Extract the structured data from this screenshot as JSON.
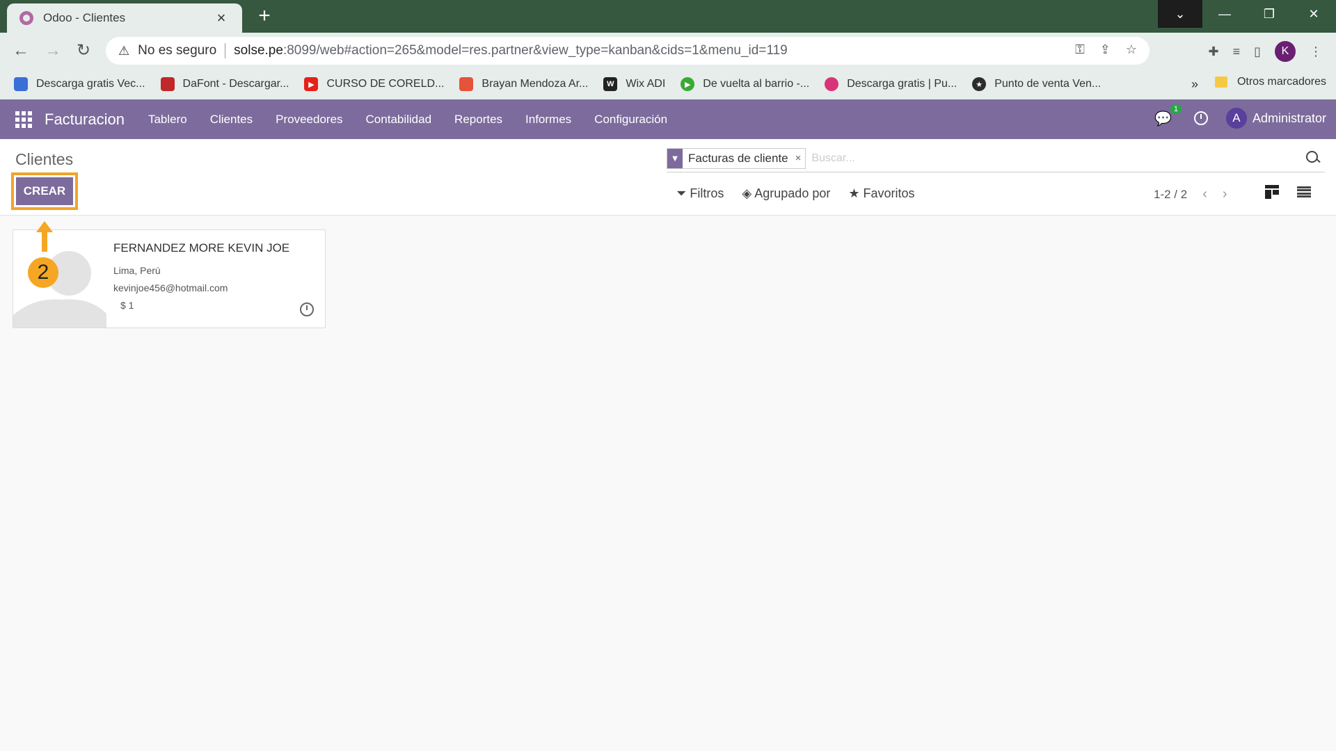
{
  "browser": {
    "tab_title": "Odoo - Clientes",
    "new_tab_symbol": "+",
    "not_secure_label": "No es seguro",
    "url_host": "solse.pe",
    "url_rest": ":8099/web#action=265&model=res.partner&view_type=kanban&cids=1&menu_id=119",
    "profile_initial": "K",
    "bookmarks": [
      {
        "label": "Descarga gratis Vec...",
        "color": "#3a6fd8"
      },
      {
        "label": "DaFont - Descargar...",
        "color": "#c0282a"
      },
      {
        "label": "CURSO DE CORELD...",
        "color": "#e62117"
      },
      {
        "label": "Brayan Mendoza Ar...",
        "color": "#e5533b"
      },
      {
        "label": "Wix ADI",
        "color": "#222222"
      },
      {
        "label": "De vuelta al barrio -...",
        "color": "#3aa935"
      },
      {
        "label": "Descarga gratis | Pu...",
        "color": "#d9337a"
      },
      {
        "label": "Punto de venta Ven...",
        "color": "#2c2c2c"
      }
    ],
    "bookmarks_more": "»",
    "other_bookmarks": "Otros marcadores"
  },
  "odoo_nav": {
    "brand": "Facturacion",
    "menu": [
      "Tablero",
      "Clientes",
      "Proveedores",
      "Contabilidad",
      "Reportes",
      "Informes",
      "Configuración"
    ],
    "chat_badge": "1",
    "user_initial": "A",
    "user_name": "Administrator"
  },
  "control_panel": {
    "breadcrumb": "Clientes",
    "create_label": "CREAR",
    "facet_label": "Facturas de cliente",
    "facet_remove": "×",
    "search_placeholder": "Buscar...",
    "filters_label": "Filtros",
    "group_by_label": "Agrupado por",
    "favorites_label": "Favoritos",
    "pager_value": "1-2 / 2",
    "pager_prev": "‹",
    "pager_next": "›"
  },
  "kanban": {
    "cards": [
      {
        "name": "FERNANDEZ MORE KEVIN JOE",
        "location": "Lima, Perú",
        "email": "kevinjoe456@hotmail.com",
        "amount": "$ 1"
      }
    ]
  },
  "annotation": {
    "step_number": "2",
    "color": "#f5a623"
  }
}
